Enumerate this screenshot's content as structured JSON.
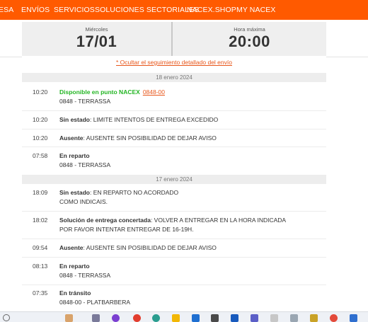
{
  "nav": {
    "items": [
      {
        "label": "ESA"
      },
      {
        "label": "ENVÍOS"
      },
      {
        "label": "SERVICIOS"
      },
      {
        "label": "SOLUCIONES SECTORIALES"
      },
      {
        "label": "NACEX.SHOP"
      },
      {
        "label": "MY NACEX"
      }
    ]
  },
  "summary": {
    "day_label": "Miércoles",
    "date_value": "17/01",
    "time_label": "Hora máxima",
    "time_value": "20:00"
  },
  "toggle_link": "* Ocultar el seguimiento detallado del envío",
  "days": [
    {
      "date": "18 enero 2024",
      "events": [
        {
          "time": "10:20",
          "status": "Disponible en punto NACEX",
          "status_color": "#23b523",
          "code": "0848-00",
          "detail": "",
          "line2": "0848 - TERRASSA"
        },
        {
          "time": "10:20",
          "status": "Sin estado",
          "detail": ": LIMITE INTENTOS DE ENTREGA EXCEDIDO",
          "line2": ""
        },
        {
          "time": "10:20",
          "status": "Ausente",
          "detail": ": AUSENTE SIN POSIBILIDAD DE DEJAR AVISO",
          "line2": ""
        },
        {
          "time": "07:58",
          "status": "En reparto",
          "detail": "",
          "line2": "0848 - TERRASSA"
        }
      ]
    },
    {
      "date": "17 enero 2024",
      "events": [
        {
          "time": "18:09",
          "status": "Sin estado",
          "detail": ": EN REPARTO NO ACORDADO",
          "line2": "COMO INDICAIS."
        },
        {
          "time": "18:02",
          "status": "Solución de entrega concertada",
          "detail": ": VOLVER A ENTREGAR EN LA HORA INDICADA",
          "line2": "POR FAVOR INTENTAR ENTREGAR DE 16-19H."
        },
        {
          "time": "09:54",
          "status": "Ausente",
          "detail": ": AUSENTE SIN POSIBILIDAD DE DEJAR AVISO",
          "line2": ""
        },
        {
          "time": "08:13",
          "status": "En reparto",
          "detail": "",
          "line2": "0848 - TERRASSA"
        },
        {
          "time": "07:35",
          "status": "En tránsito",
          "detail": "",
          "line2": "0848-00 - PLATBARBERA"
        }
      ]
    }
  ],
  "colors": {
    "brand_orange": "#ff5a00",
    "link_orange": "#e8561a",
    "status_green": "#23b523",
    "separator_gray": "#ededed"
  },
  "taskbar": {
    "icons": [
      "search-icon",
      "widgets-icon",
      "chrome-icon",
      "app-icon",
      "edge-icon",
      "folder-icon",
      "mail-icon",
      "store-icon",
      "word-icon",
      "teams-icon",
      "excel-icon",
      "app-icon",
      "app-icon",
      "app-icon",
      "app-icon",
      "app-icon",
      "app-icon",
      "grid-icon"
    ]
  }
}
